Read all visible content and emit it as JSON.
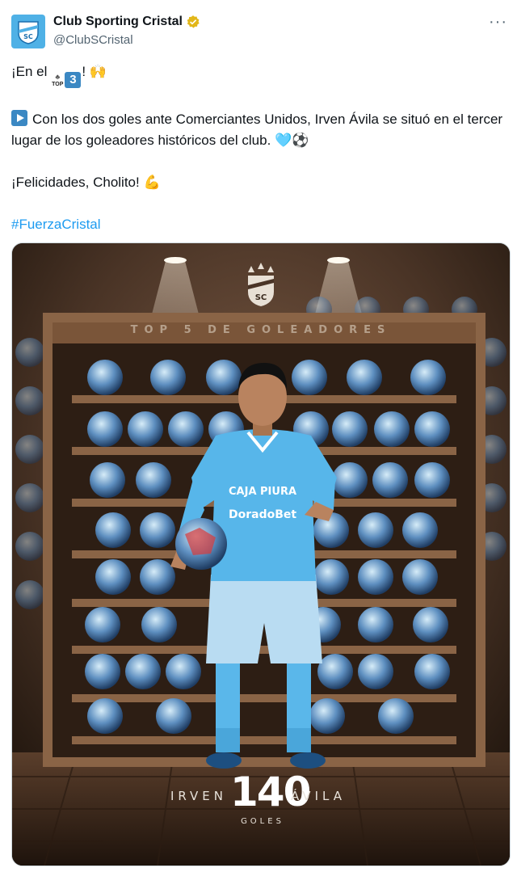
{
  "account": {
    "display_name": "Club Sporting Cristal",
    "handle": "@ClubSCristal",
    "verified_badge": "gold-verified-badge",
    "avatar_color": "#4fb1e6"
  },
  "menu_icon": "···",
  "tweet": {
    "line1_prefix": "¡En el ",
    "line1_top": "TOP",
    "line1_number": "3",
    "line1_suffix": "! 🙌",
    "line2": "Con los dos goles ante Comerciantes Unidos, Irven Ávila se situó en el tercer lugar de los goleadores históricos del club. 🩵⚽",
    "line3": "¡Felicidades, Cholito! 💪",
    "hashtag": "#FuerzaCristal",
    "hashtag_color": "#1d9bf0"
  },
  "media": {
    "shelf_title": "TOP 5 DE GOLEADORES",
    "crest_letters": "SC",
    "sponsor1": "CAJA PIURA",
    "sponsor2": "DoradoBet",
    "player_first_name": "IRVEN",
    "goals_number": "140",
    "player_last_name": "ÁVILA",
    "goals_label": "GOLES",
    "jersey_color": "#57b6ea",
    "wood_color": "#6b4a33"
  }
}
